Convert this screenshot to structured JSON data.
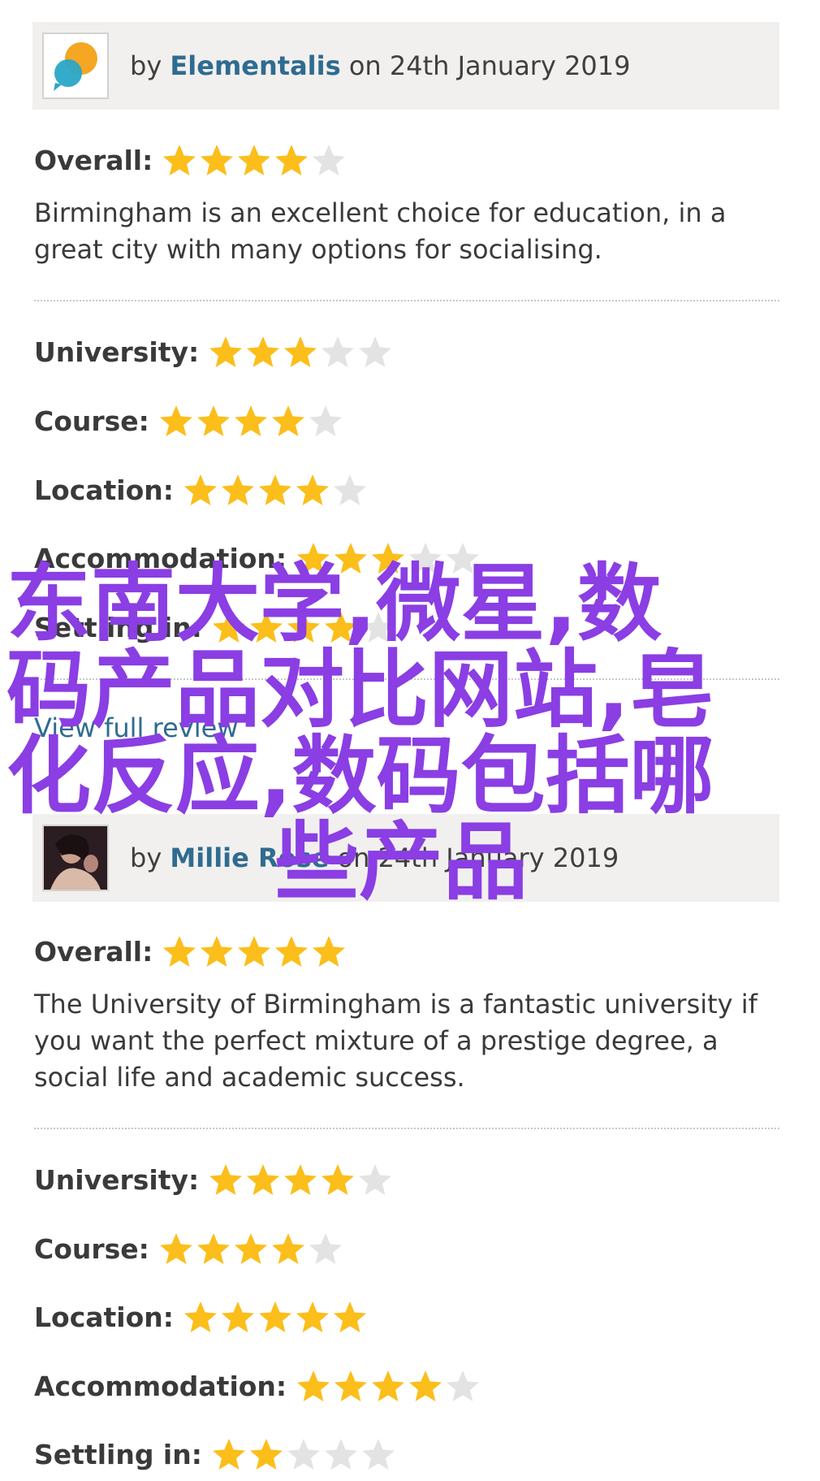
{
  "colors": {
    "star_on": "#fbbe1a",
    "star_off": "#e3e3e3",
    "link": "#2f6c8f",
    "header_bg": "#f1f0ef",
    "overlay": "#8a3ee3"
  },
  "reviews": [
    {
      "by": "by ",
      "author": "Elementalis",
      "date": " on 24th January 2019",
      "avatar_icon": "speech-bubbles-logo-icon",
      "overall_label": "Overall:",
      "overall_rating": 4,
      "description": "Birmingham is an excellent choice for education, in a great city with many options for socialising.",
      "ratings": [
        {
          "label": "University:",
          "rating": 3
        },
        {
          "label": "Course:",
          "rating": 4
        },
        {
          "label": "Location:",
          "rating": 4
        },
        {
          "label": "Accommodation:",
          "rating": 3
        },
        {
          "label": "Settling in:",
          "rating": 4
        }
      ],
      "link_text": "View full review"
    },
    {
      "by": "by ",
      "author": "Millie Rose",
      "date": " on 24th January 2019",
      "avatar_icon": "user-photo-icon",
      "overall_label": "Overall:",
      "overall_rating": 5,
      "description": "The University of Birmingham is a fantastic university if you want the perfect mixture of a prestige degree, a social life and academic success.",
      "ratings": [
        {
          "label": "University:",
          "rating": 4
        },
        {
          "label": "Course:",
          "rating": 4
        },
        {
          "label": "Location:",
          "rating": 5
        },
        {
          "label": "Accommodation:",
          "rating": 4
        },
        {
          "label": "Settling in:",
          "rating": 2
        }
      ]
    }
  ],
  "overlay": {
    "line1": "东南大学,微星,数",
    "line2": "码产品对比网站,皂",
    "line3a": "化反应,数码包括哪",
    "line3b": "些产品"
  }
}
